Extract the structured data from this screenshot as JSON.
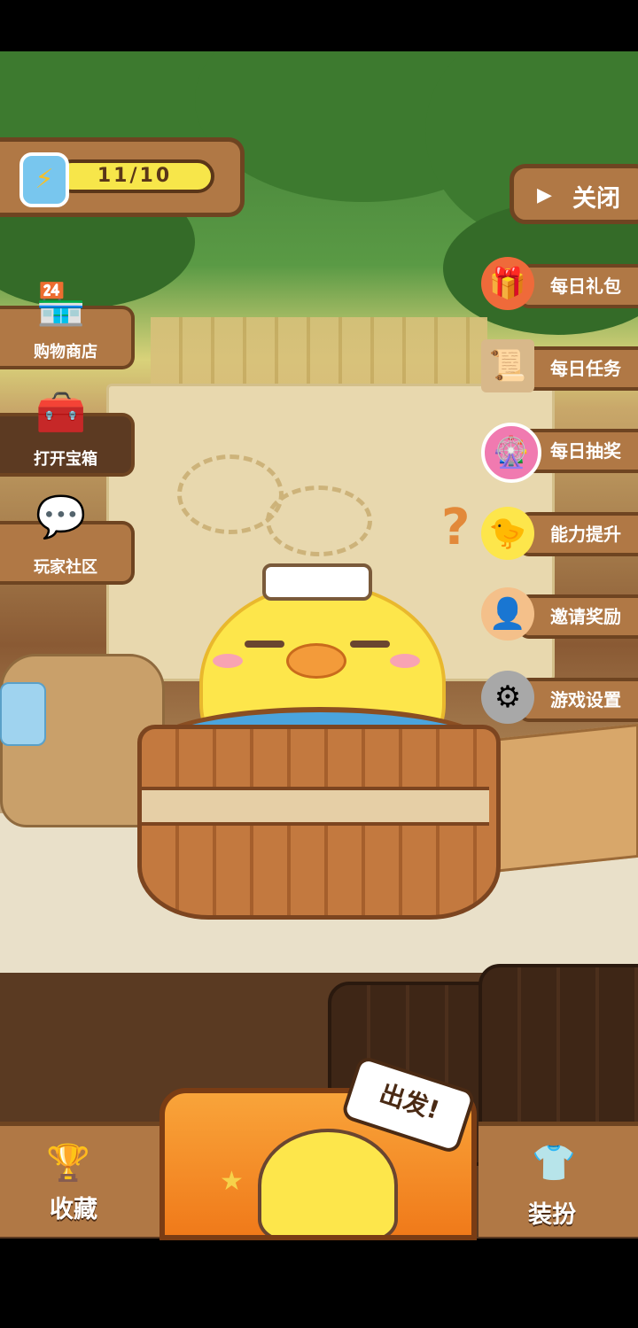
{
  "energy": {
    "value": "11/10"
  },
  "close_button": {
    "label": "关闭"
  },
  "right_menu": [
    {
      "label": "每日礼包",
      "icon": "gift-icon"
    },
    {
      "label": "每日任务",
      "icon": "wanted-poster-icon"
    },
    {
      "label": "每日抽奖",
      "icon": "lottery-wheel-icon"
    },
    {
      "label": "能力提升",
      "icon": "chick-face-icon"
    },
    {
      "label": "邀请奖励",
      "icon": "invite-person-icon"
    },
    {
      "label": "游戏设置",
      "icon": "gear-icon"
    }
  ],
  "left_menu": [
    {
      "label": "购物商店",
      "icon": "shop-icon"
    },
    {
      "label": "打开宝箱",
      "icon": "treasure-chest-icon"
    },
    {
      "label": "玩家社区",
      "icon": "chat-bubble-icon"
    }
  ],
  "bottom": {
    "collection_label": "收藏",
    "go_label": "出发!",
    "dressup_label": "装扮"
  }
}
